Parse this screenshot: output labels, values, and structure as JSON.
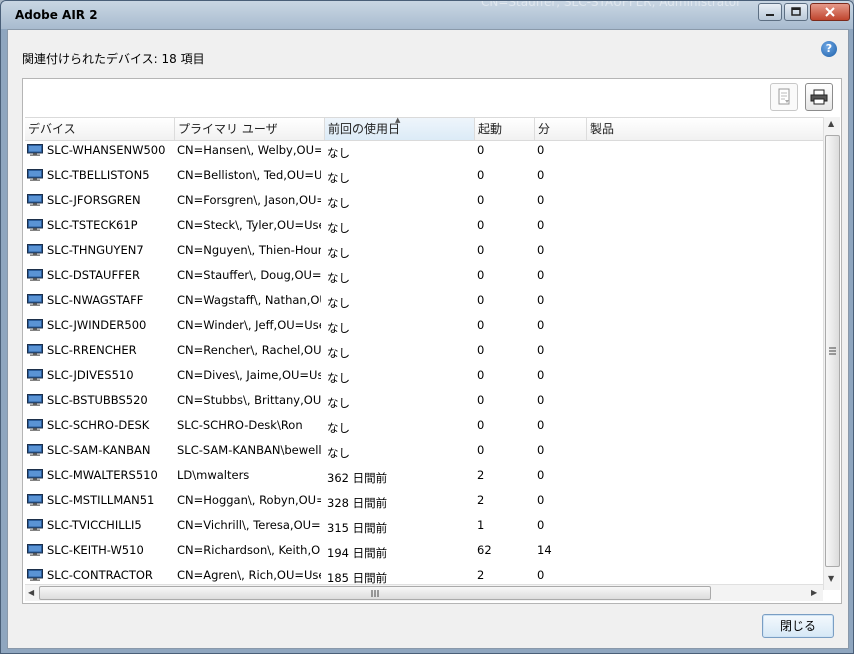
{
  "window": {
    "title": "Adobe AIR 2",
    "background_title_fragment": "CN=Stauffer, SLC-STAUFFER, Administrator"
  },
  "summary": {
    "label": "関連付けられたデバイス: 18 項目"
  },
  "help": {
    "glyph": "?"
  },
  "table": {
    "columns": [
      "デバイス",
      "プライマリ ユーザ",
      "前回の使用日",
      "起動",
      "分",
      "製品"
    ],
    "sorted_column": "前回の使用日",
    "rows": [
      {
        "device": "SLC-WHANSENW500",
        "user": "CN=Hansen\\, Welby,OU=Use",
        "last_used": "なし",
        "launches": "0",
        "minutes": "0",
        "product": ""
      },
      {
        "device": "SLC-TBELLISTON5",
        "user": "CN=Belliston\\, Ted,OU=Use",
        "last_used": "なし",
        "launches": "0",
        "minutes": "0",
        "product": ""
      },
      {
        "device": "SLC-JFORSGREN",
        "user": "CN=Forsgren\\, Jason,OU=Use",
        "last_used": "なし",
        "launches": "0",
        "minutes": "0",
        "product": ""
      },
      {
        "device": "SLC-TSTECK61P",
        "user": "CN=Steck\\, Tyler,OU=Users",
        "last_used": "なし",
        "launches": "0",
        "minutes": "0",
        "product": ""
      },
      {
        "device": "SLC-THNGUYEN7",
        "user": "CN=Nguyen\\, Thien-Hour",
        "last_used": "なし",
        "launches": "0",
        "minutes": "0",
        "product": ""
      },
      {
        "device": "SLC-DSTAUFFER",
        "user": "CN=Stauffer\\, Doug,OU=Use",
        "last_used": "なし",
        "launches": "0",
        "minutes": "0",
        "product": ""
      },
      {
        "device": "SLC-NWAGSTAFF",
        "user": "CN=Wagstaff\\, Nathan,OU=",
        "last_used": "なし",
        "launches": "0",
        "minutes": "0",
        "product": ""
      },
      {
        "device": "SLC-JWINDER500",
        "user": "CN=Winder\\, Jeff,OU=Users",
        "last_used": "なし",
        "launches": "0",
        "minutes": "0",
        "product": ""
      },
      {
        "device": "SLC-RRENCHER",
        "user": "CN=Rencher\\, Rachel,OU=Use",
        "last_used": "なし",
        "launches": "0",
        "minutes": "0",
        "product": ""
      },
      {
        "device": "SLC-JDIVES510",
        "user": "CN=Dives\\, Jaime,OU=Users",
        "last_used": "なし",
        "launches": "0",
        "minutes": "0",
        "product": ""
      },
      {
        "device": "SLC-BSTUBBS520",
        "user": "CN=Stubbs\\, Brittany,OU=",
        "last_used": "なし",
        "launches": "0",
        "minutes": "0",
        "product": ""
      },
      {
        "device": "SLC-SCHRO-DESK",
        "user": "SLC-SCHRO-Desk\\Ron",
        "last_used": "なし",
        "launches": "0",
        "minutes": "0",
        "product": ""
      },
      {
        "device": "SLC-SAM-KANBAN",
        "user": "SLC-SAM-KANBAN\\bewell",
        "last_used": "なし",
        "launches": "0",
        "minutes": "0",
        "product": ""
      },
      {
        "device": "SLC-MWALTERS510",
        "user": "LD\\mwalters",
        "last_used": "362 日間前",
        "launches": "2",
        "minutes": "0",
        "product": ""
      },
      {
        "device": "SLC-MSTILLMAN51",
        "user": "CN=Hoggan\\, Robyn,OU=Use",
        "last_used": "328 日間前",
        "launches": "2",
        "minutes": "0",
        "product": ""
      },
      {
        "device": "SLC-TVICCHILLI5",
        "user": "CN=Vichrill\\, Teresa,OU=",
        "last_used": "315 日間前",
        "launches": "1",
        "minutes": "0",
        "product": ""
      },
      {
        "device": "SLC-KEITH-W510",
        "user": "CN=Richardson\\, Keith,OU",
        "last_used": "194 日間前",
        "launches": "62",
        "minutes": "14",
        "product": ""
      },
      {
        "device": "SLC-CONTRACTOR",
        "user": "CN=Agren\\, Rich,OU=Users",
        "last_used": "185 日間前",
        "launches": "2",
        "minutes": "0",
        "product": ""
      }
    ]
  },
  "buttons": {
    "close": "閉じる"
  },
  "icons": {
    "device_row": "monitor-icon",
    "export": "export-document-icon",
    "print": "printer-icon"
  },
  "colors": {
    "title_bar": "#b8c8d8",
    "close_button_red": "#c0452e",
    "monitor_screen": "#2a5d9c"
  }
}
